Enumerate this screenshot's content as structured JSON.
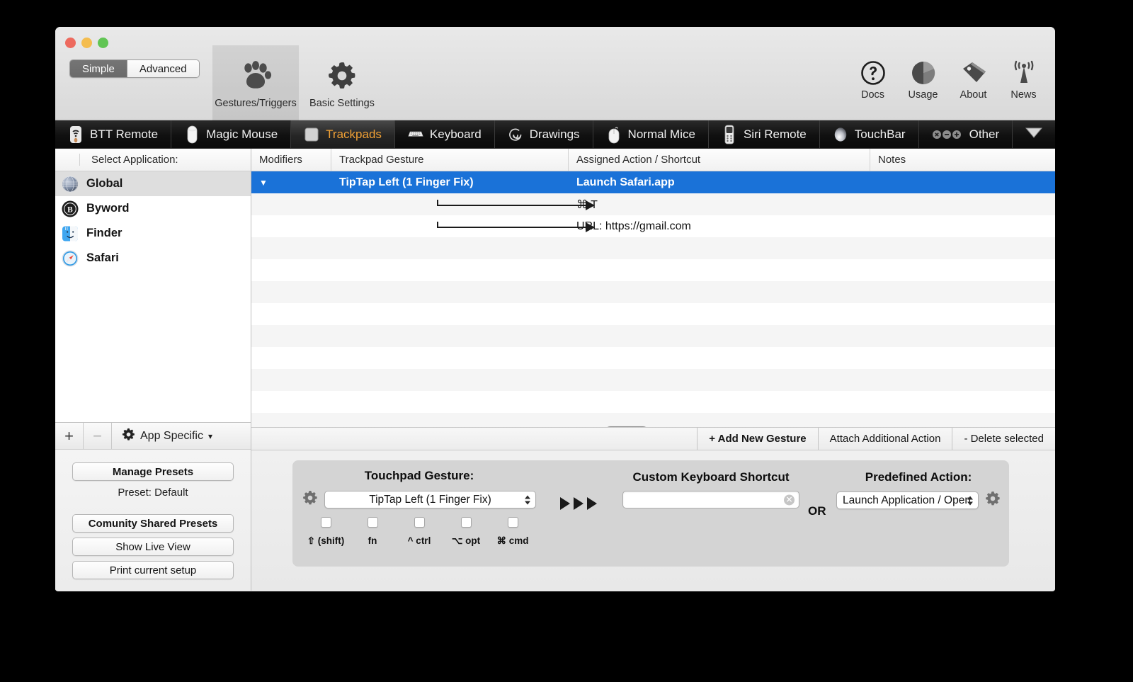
{
  "window": {
    "traffic_lights": [
      "close",
      "minimize",
      "zoom"
    ]
  },
  "toolbar": {
    "mode_segments": [
      {
        "label": "Simple",
        "active": true
      },
      {
        "label": "Advanced",
        "active": false
      }
    ],
    "items": [
      {
        "label": "Gestures/Triggers",
        "icon": "paw-icon",
        "selected": true
      },
      {
        "label": "Basic Settings",
        "icon": "gear-icon",
        "selected": false
      }
    ],
    "right_items": [
      {
        "label": "Docs",
        "icon": "question-mark-icon"
      },
      {
        "label": "Usage",
        "icon": "pie-chart-icon"
      },
      {
        "label": "About",
        "icon": "tag-icon"
      },
      {
        "label": "News",
        "icon": "broadcast-antenna-icon"
      }
    ]
  },
  "tabs": [
    {
      "label": "BTT Remote",
      "icon": "btt-remote-icon",
      "active": false
    },
    {
      "label": "Magic Mouse",
      "icon": "magic-mouse-icon",
      "active": false
    },
    {
      "label": "Trackpads",
      "icon": "trackpad-icon",
      "active": true
    },
    {
      "label": "Keyboard",
      "icon": "keyboard-icon",
      "active": false
    },
    {
      "label": "Drawings",
      "icon": "spiral-icon",
      "active": false
    },
    {
      "label": "Normal Mice",
      "icon": "mouse-icon",
      "active": false
    },
    {
      "label": "Siri Remote",
      "icon": "siri-remote-icon",
      "active": false
    },
    {
      "label": "TouchBar",
      "icon": "touchbar-icon",
      "active": false
    },
    {
      "label": "Other",
      "icon": "three-dots-icon",
      "active": false
    }
  ],
  "tab_overflow_icon": "chevron-down-icon",
  "sidebar": {
    "header": "Select Application:",
    "apps": [
      {
        "name": "Global",
        "icon": "globe-icon",
        "selected": true
      },
      {
        "name": "Byword",
        "icon": "byword-app-icon",
        "selected": false
      },
      {
        "name": "Finder",
        "icon": "finder-app-icon",
        "selected": false
      },
      {
        "name": "Safari",
        "icon": "safari-app-icon",
        "selected": false
      }
    ],
    "toolbar": {
      "add_label": "+",
      "remove_label": "−",
      "app_specific_label": "App Specific",
      "app_specific_icon": "gear-icon",
      "app_specific_caret": "▾"
    },
    "presets": {
      "manage_label": "Manage Presets",
      "current_preset": "Preset: Default",
      "community_label": "Comunity Shared Presets",
      "live_view_label": "Show Live View",
      "print_label": "Print current setup"
    }
  },
  "table": {
    "columns": [
      "Modifiers",
      "Trackpad Gesture",
      "Assigned Action / Shortcut",
      "Notes"
    ],
    "rows": [
      {
        "type": "parent",
        "selected": true,
        "disclosure": "▼",
        "gesture": "TipTap Left (1 Finger Fix)",
        "action": "Launch Safari.app",
        "notes": ""
      },
      {
        "type": "child",
        "selected": false,
        "disclosure": "",
        "gesture": "",
        "action": "⌘ T",
        "notes": ""
      },
      {
        "type": "child",
        "selected": false,
        "disclosure": "",
        "gesture": "",
        "action": "URL: https://gmail.com",
        "notes": ""
      }
    ],
    "empty_row_count": 15
  },
  "action_buttons": [
    {
      "label": "+ Add New Gesture",
      "bold": true
    },
    {
      "label": "Attach Additional Action",
      "bold": false
    },
    {
      "label": "- Delete selected",
      "bold": false
    }
  ],
  "editor": {
    "gesture": {
      "title": "Touchpad Gesture:",
      "gear_icon": "gear-icon",
      "selected_value": "TipTap Left (1 Finger Fix)",
      "modifiers": [
        {
          "label": "⇧ (shift)",
          "checked": false
        },
        {
          "label": "fn",
          "checked": false
        },
        {
          "label": "^ ctrl",
          "checked": false
        },
        {
          "label": "⌥ opt",
          "checked": false
        },
        {
          "label": "⌘ cmd",
          "checked": false
        }
      ]
    },
    "arrows_icon": "triple-right-arrow-icon",
    "shortcut": {
      "title": "Custom Keyboard Shortcut",
      "value": "",
      "placeholder": "",
      "clear_icon": "clear-circle-icon"
    },
    "or_label": "OR",
    "predefined": {
      "title": "Predefined Action:",
      "selected_value": "Launch Application / Open",
      "gear_icon": "gear-icon"
    }
  },
  "colors": {
    "selection_blue": "#1a72d8",
    "active_tab_text": "#f0a035",
    "window_chrome": "#ececec",
    "tabbar_dark": "#101010"
  }
}
